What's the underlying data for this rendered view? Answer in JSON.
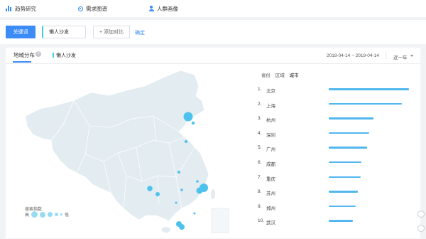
{
  "nav": {
    "items": [
      {
        "label": "趋势研究",
        "icon": "bar-chart-icon"
      },
      {
        "label": "需求图谱",
        "icon": "radio-icon"
      },
      {
        "label": "人群画像",
        "icon": "user-icon"
      }
    ]
  },
  "search": {
    "keyword_button": "关键词",
    "keyword_value": "懒人沙发",
    "add_compare": "+ 添加对比",
    "confirm": "确定"
  },
  "panel": {
    "tab_label": "地域分布",
    "help_icon": "?",
    "legend_keyword": "懒人沙发",
    "date_range": "2018-04-14 ~ 2019-04-14",
    "period": "近一年",
    "region_tabs": [
      "省份",
      "区域",
      "城市"
    ],
    "active_region_tab": "城市"
  },
  "ranking": [
    {
      "rank": "1.",
      "city": "北京",
      "value": 1.0
    },
    {
      "rank": "2.",
      "city": "上海",
      "value": 0.91
    },
    {
      "rank": "3.",
      "city": "杭州",
      "value": 0.56
    },
    {
      "rank": "4.",
      "city": "深圳",
      "value": 0.5
    },
    {
      "rank": "5.",
      "city": "广州",
      "value": 0.48
    },
    {
      "rank": "6.",
      "city": "成都",
      "value": 0.41
    },
    {
      "rank": "7.",
      "city": "重庆",
      "value": 0.4
    },
    {
      "rank": "8.",
      "city": "苏州",
      "value": 0.36
    },
    {
      "rank": "9.",
      "city": "郑州",
      "value": 0.34
    },
    {
      "rank": "10.",
      "city": "武汉",
      "value": 0.3
    }
  ],
  "map_legend": {
    "title": "搜索指数",
    "high": "高",
    "low": "低"
  },
  "colors": {
    "accent": "#3b8cf6",
    "bar": "#52b7ef",
    "bubble": "#4ec2ef",
    "map_fill": "#e3ecf1"
  },
  "side_icons": [
    "headset-icon",
    "share-icon"
  ]
}
